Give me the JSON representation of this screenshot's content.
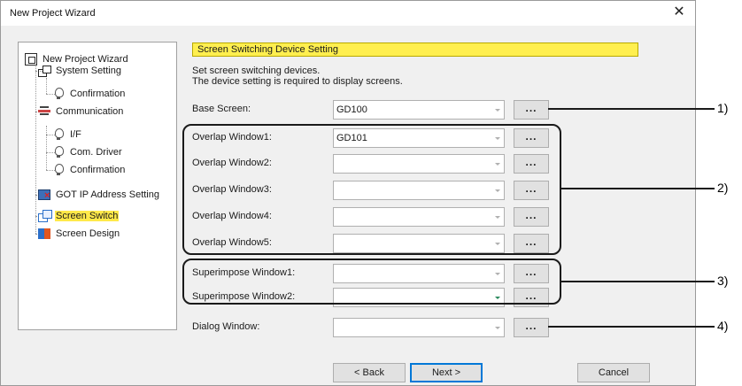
{
  "window": {
    "title": "New Project Wizard",
    "close_glyph": "✕"
  },
  "tree": {
    "items": [
      {
        "label": "New Project Wizard",
        "icon": "wizard-icon"
      },
      {
        "label": "System Setting",
        "icon": "system-icon"
      },
      {
        "label": "Confirmation",
        "icon": "bulb-icon"
      },
      {
        "label": "Communication",
        "icon": "communication-icon"
      },
      {
        "label": "I/F",
        "icon": "bulb-icon"
      },
      {
        "label": "Com. Driver",
        "icon": "bulb-icon"
      },
      {
        "label": "Confirmation",
        "icon": "bulb-icon"
      },
      {
        "label": "GOT IP Address Setting",
        "icon": "network-icon"
      },
      {
        "label": "Screen Switch",
        "icon": "screen-switch-icon",
        "selected": true
      },
      {
        "label": "Screen Design",
        "icon": "screen-design-icon"
      }
    ]
  },
  "panel": {
    "header": "Screen Switching Device Setting",
    "description_line1": "Set screen switching devices.",
    "description_line2": "The device setting is required to display screens.",
    "fields": [
      {
        "label": "Base Screen:",
        "value": "GD100"
      },
      {
        "label": "Overlap Window1:",
        "value": "GD101"
      },
      {
        "label": "Overlap Window2:",
        "value": ""
      },
      {
        "label": "Overlap Window3:",
        "value": ""
      },
      {
        "label": "Overlap Window4:",
        "value": ""
      },
      {
        "label": "Overlap Window5:",
        "value": ""
      },
      {
        "label": "Superimpose Window1:",
        "value": ""
      },
      {
        "label": "Superimpose Window2:",
        "value": ""
      },
      {
        "label": "Dialog Window:",
        "value": ""
      }
    ],
    "browse_label": "..."
  },
  "callouts": [
    "1)",
    "2)",
    "3)",
    "4)"
  ],
  "buttons": {
    "back": "< Back",
    "next": "Next >",
    "cancel": "Cancel"
  },
  "colors": {
    "selection_highlight": "#ffe94a",
    "header_bg": "#ffef4f",
    "default_button_border": "#0078d7"
  }
}
